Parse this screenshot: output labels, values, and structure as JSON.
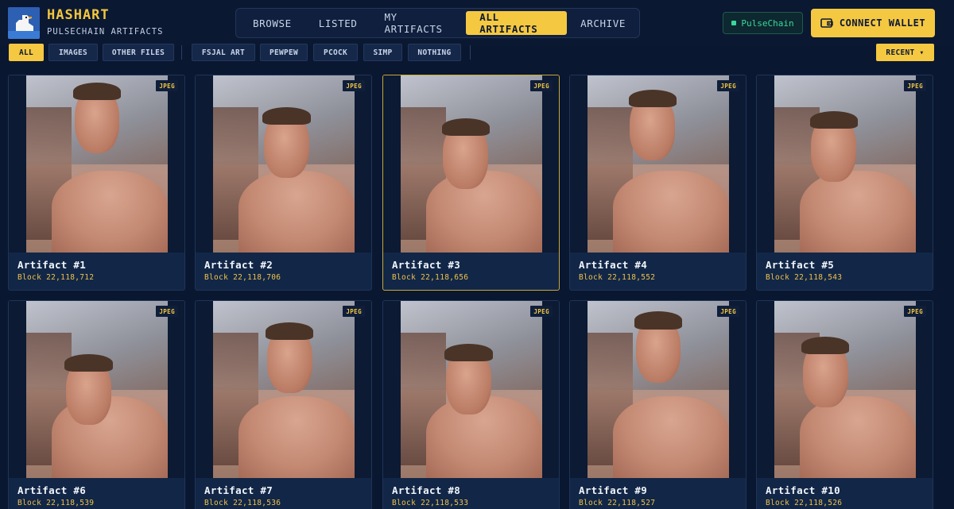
{
  "brand": {
    "title": "HASHART",
    "subtitle": "PULSECHAIN ARTIFACTS",
    "logo_icon": "duck-icon"
  },
  "nav": {
    "tabs": [
      {
        "label": "BROWSE",
        "active": false
      },
      {
        "label": "LISTED",
        "active": false
      },
      {
        "label": "MY ARTIFACTS",
        "active": false
      },
      {
        "label": "ALL ARTIFACTS",
        "active": true
      },
      {
        "label": "ARCHIVE",
        "active": false
      }
    ]
  },
  "network": {
    "label": "PulseChain",
    "color": "#3ad89a"
  },
  "wallet": {
    "connect_label": "CONNECT WALLET",
    "icon": "wallet-icon"
  },
  "filters": {
    "type_chips": [
      {
        "label": "ALL",
        "active": true
      },
      {
        "label": "IMAGES",
        "active": false
      },
      {
        "label": "OTHER FILES",
        "active": false
      }
    ],
    "collection_chips": [
      {
        "label": "FSJAL ART"
      },
      {
        "label": "PEWPEW"
      },
      {
        "label": "PCOCK"
      },
      {
        "label": "SIMP"
      },
      {
        "label": "NOTHING"
      }
    ],
    "sort": {
      "label": "RECENT ▾"
    }
  },
  "artifacts": [
    {
      "title": "Artifact #1",
      "block": "Block 22,118,712",
      "format": "JPEG",
      "selected": false
    },
    {
      "title": "Artifact #2",
      "block": "Block 22,118,706",
      "format": "JPEG",
      "selected": false
    },
    {
      "title": "Artifact #3",
      "block": "Block 22,118,656",
      "format": "JPEG",
      "selected": true
    },
    {
      "title": "Artifact #4",
      "block": "Block 22,118,552",
      "format": "JPEG",
      "selected": false
    },
    {
      "title": "Artifact #5",
      "block": "Block 22,118,543",
      "format": "JPEG",
      "selected": false
    },
    {
      "title": "Artifact #6",
      "block": "Block 22,118,539",
      "format": "JPEG",
      "selected": false
    },
    {
      "title": "Artifact #7",
      "block": "Block 22,118,536",
      "format": "JPEG",
      "selected": false
    },
    {
      "title": "Artifact #8",
      "block": "Block 22,118,533",
      "format": "JPEG",
      "selected": false
    },
    {
      "title": "Artifact #9",
      "block": "Block 22,118,527",
      "format": "JPEG",
      "selected": false
    },
    {
      "title": "Artifact #10",
      "block": "Block 22,118,526",
      "format": "JPEG",
      "selected": false
    }
  ],
  "colors": {
    "accent": "#f5c842",
    "background": "#0a1730",
    "card": "#122747"
  }
}
